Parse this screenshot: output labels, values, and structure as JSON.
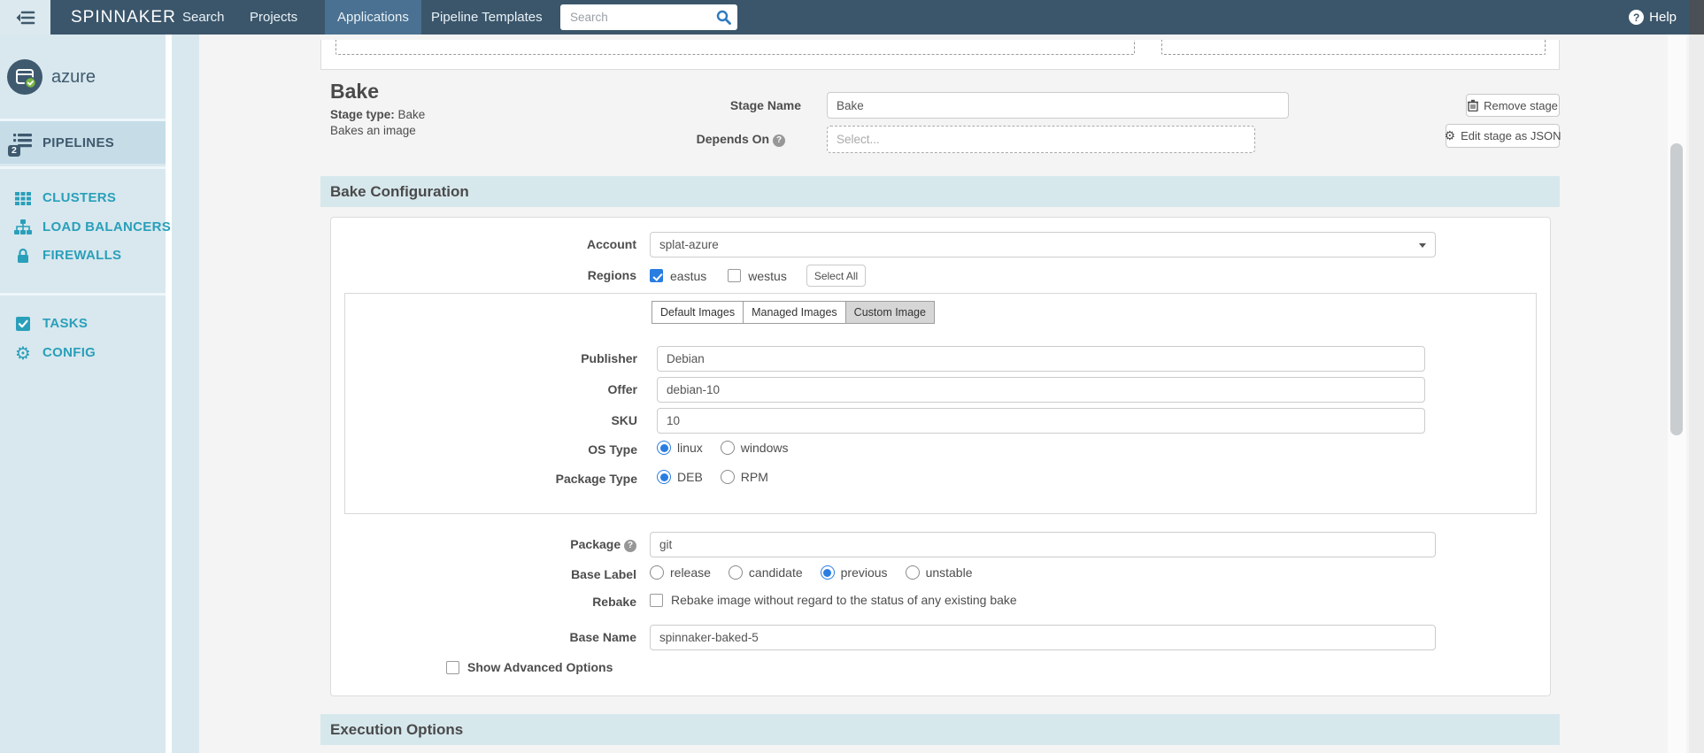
{
  "colors": {
    "navbar_bg": "#3b566b",
    "navbar_active_bg": "#4a7191",
    "sidebar_bg": "#d8e8ee",
    "sidebar_active_bg": "#c6dde8",
    "sidebar_teal": "#2a9fba",
    "sidebar_dark": "#3f5a6e",
    "section_band_bg": "#d7e8ed",
    "checked_blue": "#2a7de1",
    "search_icon_blue": "#2e7bbf",
    "badge_green": "#78b742"
  },
  "icons": {
    "gear": "⚙"
  },
  "navbar": {
    "brand": "SPINNAKER",
    "items": [
      {
        "label": "Search",
        "active": false
      },
      {
        "label": "Projects",
        "active": false
      },
      {
        "label": "Applications",
        "active": true
      },
      {
        "label": "Pipeline Templates",
        "active": false
      }
    ],
    "search": {
      "placeholder": "Search",
      "value": ""
    },
    "help_label": "Help"
  },
  "sidebar": {
    "app_name": "azure",
    "pipelines": {
      "label": "PIPELINES",
      "badge": "2"
    },
    "items": [
      {
        "label": "CLUSTERS",
        "icon": "grid-icon"
      },
      {
        "label": "LOAD BALANCERS",
        "icon": "sitemap-icon"
      },
      {
        "label": "FIREWALLS",
        "icon": "lock-icon"
      },
      {
        "label": "TASKS",
        "icon": "check-square-icon"
      },
      {
        "label": "CONFIG",
        "icon": "gear-icon"
      }
    ]
  },
  "stage": {
    "title": "Bake",
    "type_label": "Stage type:",
    "type_value": "Bake",
    "description": "Bakes an image",
    "stage_name_label": "Stage Name",
    "stage_name_value": "Bake",
    "depends_on_label": "Depends On",
    "depends_on_placeholder": "Select...",
    "remove_stage_label": "Remove stage",
    "edit_json_label": "Edit stage as JSON"
  },
  "bake_config": {
    "section_title": "Bake Configuration",
    "account_label": "Account",
    "account_value": "splat-azure",
    "regions_label": "Regions",
    "regions": [
      {
        "name": "eastus",
        "checked": true
      },
      {
        "name": "westus",
        "checked": false
      }
    ],
    "select_all_label": "Select All",
    "image_tabs": [
      {
        "label": "Default Images",
        "active": false
      },
      {
        "label": "Managed Images",
        "active": false
      },
      {
        "label": "Custom Image",
        "active": true
      }
    ],
    "publisher_label": "Publisher",
    "publisher_value": "Debian",
    "offer_label": "Offer",
    "offer_value": "debian-10",
    "sku_label": "SKU",
    "sku_value": "10",
    "os_type_label": "OS Type",
    "os_types": [
      {
        "label": "linux",
        "selected": true
      },
      {
        "label": "windows",
        "selected": false
      }
    ],
    "package_type_label": "Package Type",
    "package_types": [
      {
        "label": "DEB",
        "selected": true
      },
      {
        "label": "RPM",
        "selected": false
      }
    ],
    "package_label": "Package",
    "package_value": "git",
    "base_label_label": "Base Label",
    "base_labels": [
      {
        "label": "release",
        "selected": false
      },
      {
        "label": "candidate",
        "selected": false
      },
      {
        "label": "previous",
        "selected": true
      },
      {
        "label": "unstable",
        "selected": false
      }
    ],
    "rebake_label": "Rebake",
    "rebake_text": "Rebake image without regard to the status of any existing bake",
    "rebake_checked": false,
    "base_name_label": "Base Name",
    "base_name_value": "spinnaker-baked-5",
    "show_advanced_label": "Show Advanced Options",
    "show_advanced_checked": false
  },
  "execution_options": {
    "section_title": "Execution Options"
  }
}
